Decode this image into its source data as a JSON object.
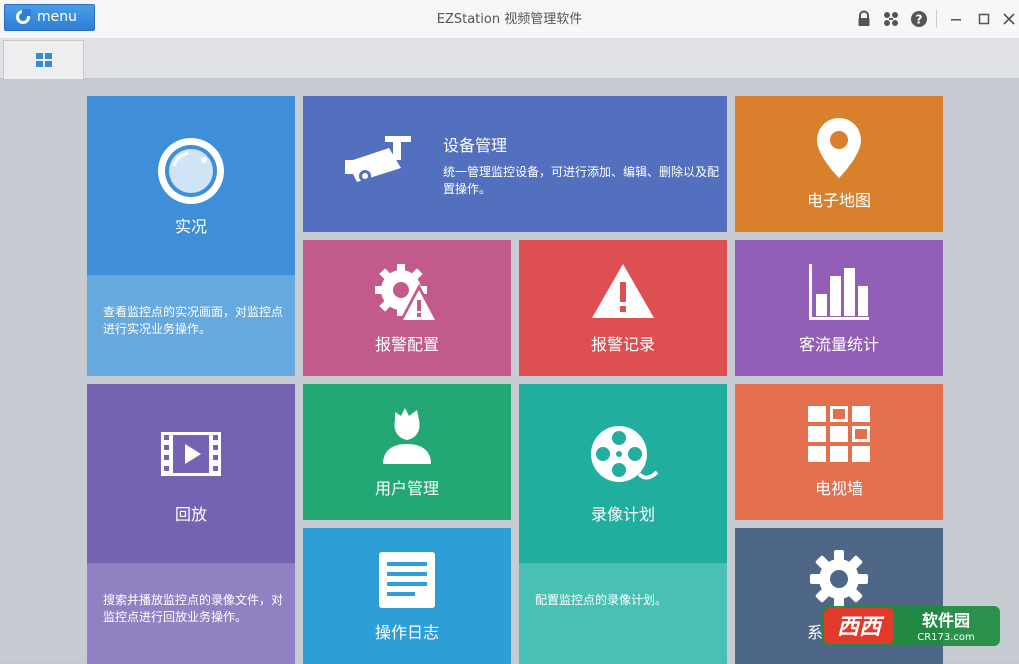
{
  "titlebar": {
    "menu_label": "menu",
    "app_title": "EZStation 视频管理软件"
  },
  "tiles": {
    "live": {
      "title": "实况",
      "desc": "查看监控点的实况画面，对监控点进行实况业务操作。",
      "color": "#3f8fd8",
      "desc_color": "#66a9df"
    },
    "device": {
      "title": "设备管理",
      "desc": "统一管理监控设备，可进行添加、编辑、删除以及配置操作。",
      "color": "#5370bf"
    },
    "emap": {
      "title": "电子地图",
      "color": "#d8802c"
    },
    "alarm_config": {
      "title": "报警配置",
      "color": "#c35a8c"
    },
    "alarm_record": {
      "title": "报警记录",
      "color": "#dd4f50"
    },
    "traffic": {
      "title": "客流量统计",
      "color": "#935fb6"
    },
    "playback": {
      "title": "回放",
      "desc": "搜索并播放监控点的录像文件，对监控点进行回放业务操作。",
      "color": "#7462b3",
      "desc_color": "#9281c2"
    },
    "users": {
      "title": "用户管理",
      "color": "#24a873"
    },
    "record_plan": {
      "title": "录像计划",
      "desc": "配置监控点的录像计划。",
      "color": "#21ae9f",
      "desc_color": "#48c0b4"
    },
    "tv_wall": {
      "title": "电视墙",
      "color": "#e2704f"
    },
    "logs": {
      "title": "操作日志",
      "color": "#2e9fd6"
    },
    "system": {
      "title": "系统配置",
      "color": "#4e6786"
    }
  },
  "watermark": {
    "brand": "西西",
    "text": "软件园",
    "url": "CR173.com"
  }
}
